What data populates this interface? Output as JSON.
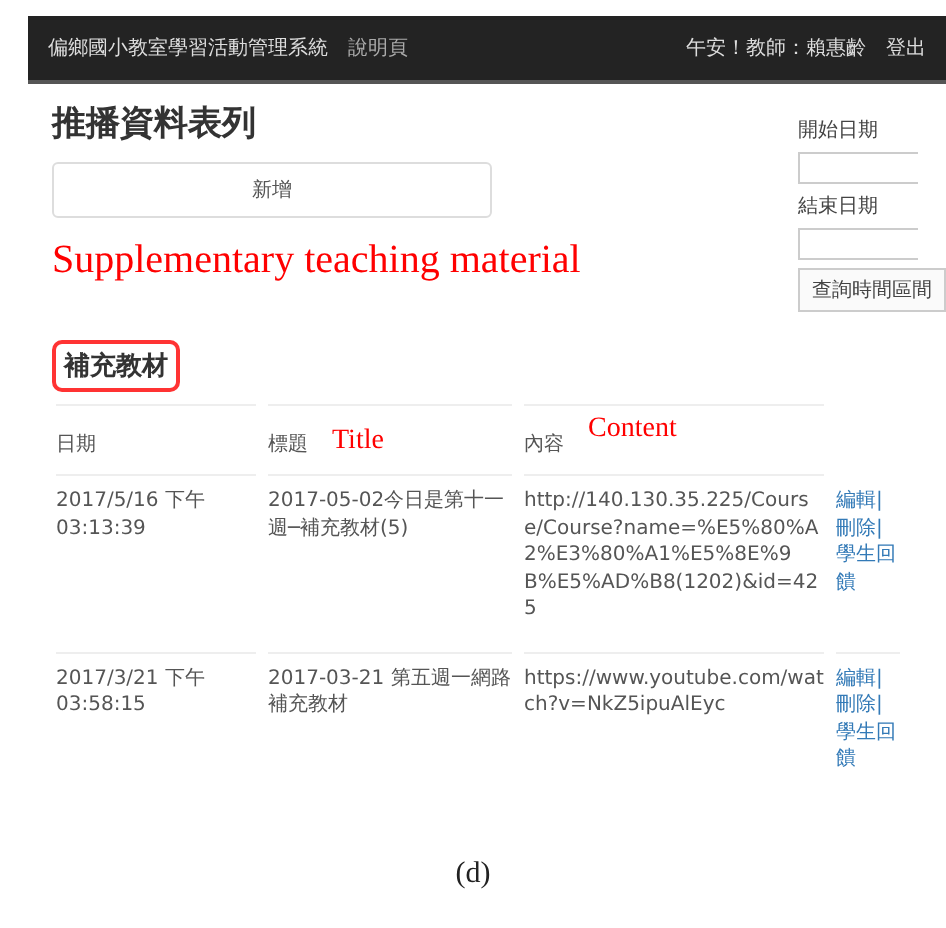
{
  "navbar": {
    "title": "偏鄉國小教室學習活動管理系統",
    "link": "說明頁",
    "user": "午安！教師：賴惠齡",
    "logout": "登出"
  },
  "page_title": "推播資料表列",
  "add_button": "新增",
  "date_filter": {
    "start_label": "開始日期",
    "end_label": "結束日期",
    "query_button": "查詢時間區間"
  },
  "annotations": {
    "section": "Supplementary teaching material",
    "title_column": "Title",
    "content_column": "Content"
  },
  "section": {
    "title": "補充教材",
    "highlighted": true
  },
  "table": {
    "columns": [
      "日期",
      "標題",
      "內容"
    ],
    "rows": [
      {
        "date": "2017/5/16 下午 03:13:39",
        "title": "2017-05-02今日是第十一週─補充教材(5)",
        "content": "http://140.130.35.225/Course/Course?name=%E5%80%A2%E3%80%A1%E5%8E%9B%E5%AD%B8(1202)&id=425",
        "actions": [
          "編輯|",
          "刪除|",
          "學生回饋"
        ]
      },
      {
        "date": "2017/3/21 下午 03:58:15",
        "title": "2017-03-21 第五週一網路補充教材",
        "content": "https://www.youtube.com/watch?v=NkZ5ipuAlEyc",
        "actions": [
          "編輯|",
          "刪除|",
          "學生回饋"
        ]
      }
    ]
  },
  "caption": "(d)"
}
